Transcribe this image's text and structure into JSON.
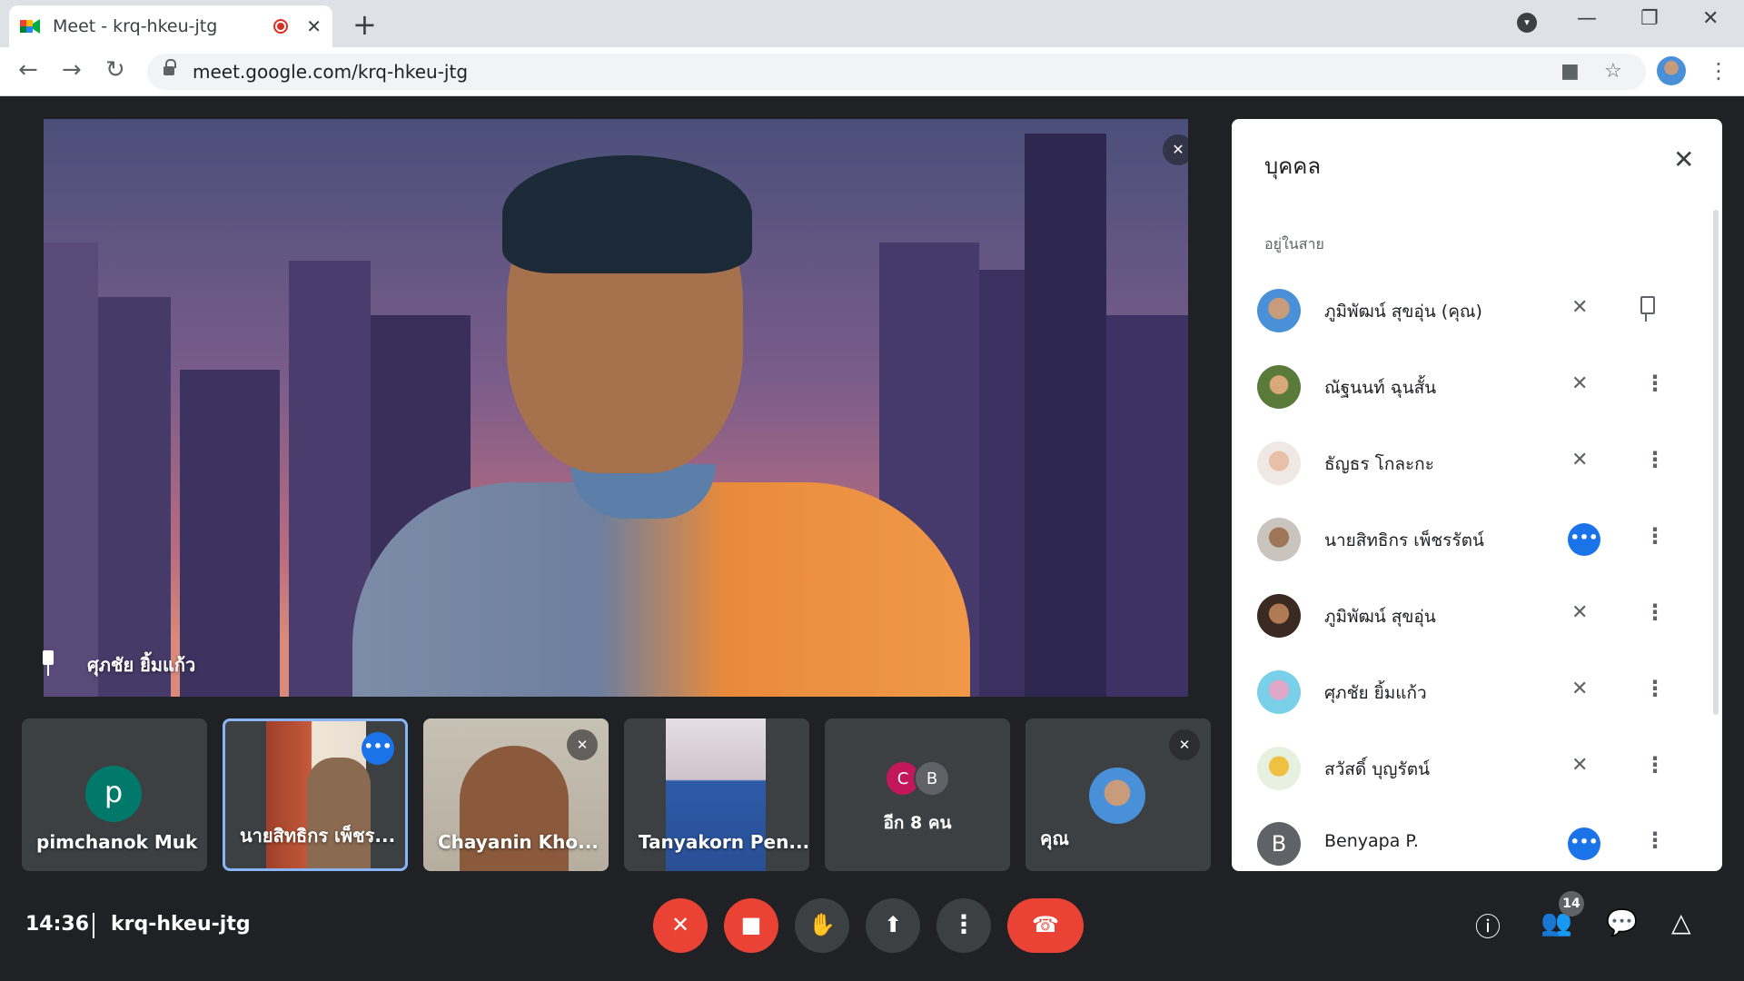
{
  "browser": {
    "tab_title": "Meet - krq-hkeu-jtg",
    "tab_close": "✕",
    "new_tab": "+",
    "url": "meet.google.com/krq-hkeu-jtg",
    "icons": [
      "meet-favicon",
      "recording-dot",
      "back-arrow",
      "forward-arrow",
      "reload",
      "lock",
      "camera",
      "star",
      "profile",
      "kebab-menu",
      "minimize",
      "maximize",
      "close"
    ]
  },
  "main_video": {
    "pinned_name": "ศุภชัย ยิ้มแก้ว"
  },
  "tiles": [
    {
      "name": "pimchanok Muk",
      "avatar_letter": "p"
    },
    {
      "name": "นายสิทธิกร เพ็ชร...",
      "status": "more"
    },
    {
      "name": "Chayanin Kho...",
      "status": "muted"
    },
    {
      "name": "Tanyakorn Pen..."
    },
    {
      "more_label": "อีก 8 คน",
      "avatar_c": "C",
      "avatar_b": "B"
    },
    {
      "name": "คุณ",
      "status": "muted"
    }
  ],
  "panel": {
    "title": "บุคคล",
    "section": "อยู่ในสาย",
    "people": [
      {
        "name": "ภูมิพัฒน์ สุขอุ่น (คุณ)",
        "status": "muted",
        "action": "pin"
      },
      {
        "name": "ณัฐนนท์ ฉุนสั้น",
        "status": "muted",
        "action": "more"
      },
      {
        "name": "ธัญธร โกละกะ",
        "status": "muted",
        "action": "more"
      },
      {
        "name": "นายสิทธิกร เพ็ชรรัตน์",
        "status": "speaking",
        "action": "more"
      },
      {
        "name": "ภูมิพัฒน์ สุขอุ่น",
        "status": "muted",
        "action": "more"
      },
      {
        "name": "ศุภชัย ยิ้มแก้ว",
        "status": "muted",
        "action": "more"
      },
      {
        "name": "สวัสดิ์ บุญรัตน์",
        "status": "muted",
        "action": "more"
      },
      {
        "name": "Benyapa P.",
        "avatar_letter": "B",
        "status": "speaking",
        "action": "more"
      }
    ]
  },
  "bottom_bar": {
    "time": "14:36",
    "meeting_code": "krq-hkeu-jtg",
    "participant_count": "14"
  },
  "colors": {
    "accent_blue": "#1a73e8",
    "danger_red": "#ea4335",
    "dark_bg": "#202124",
    "tile_bg": "#3c4043"
  }
}
